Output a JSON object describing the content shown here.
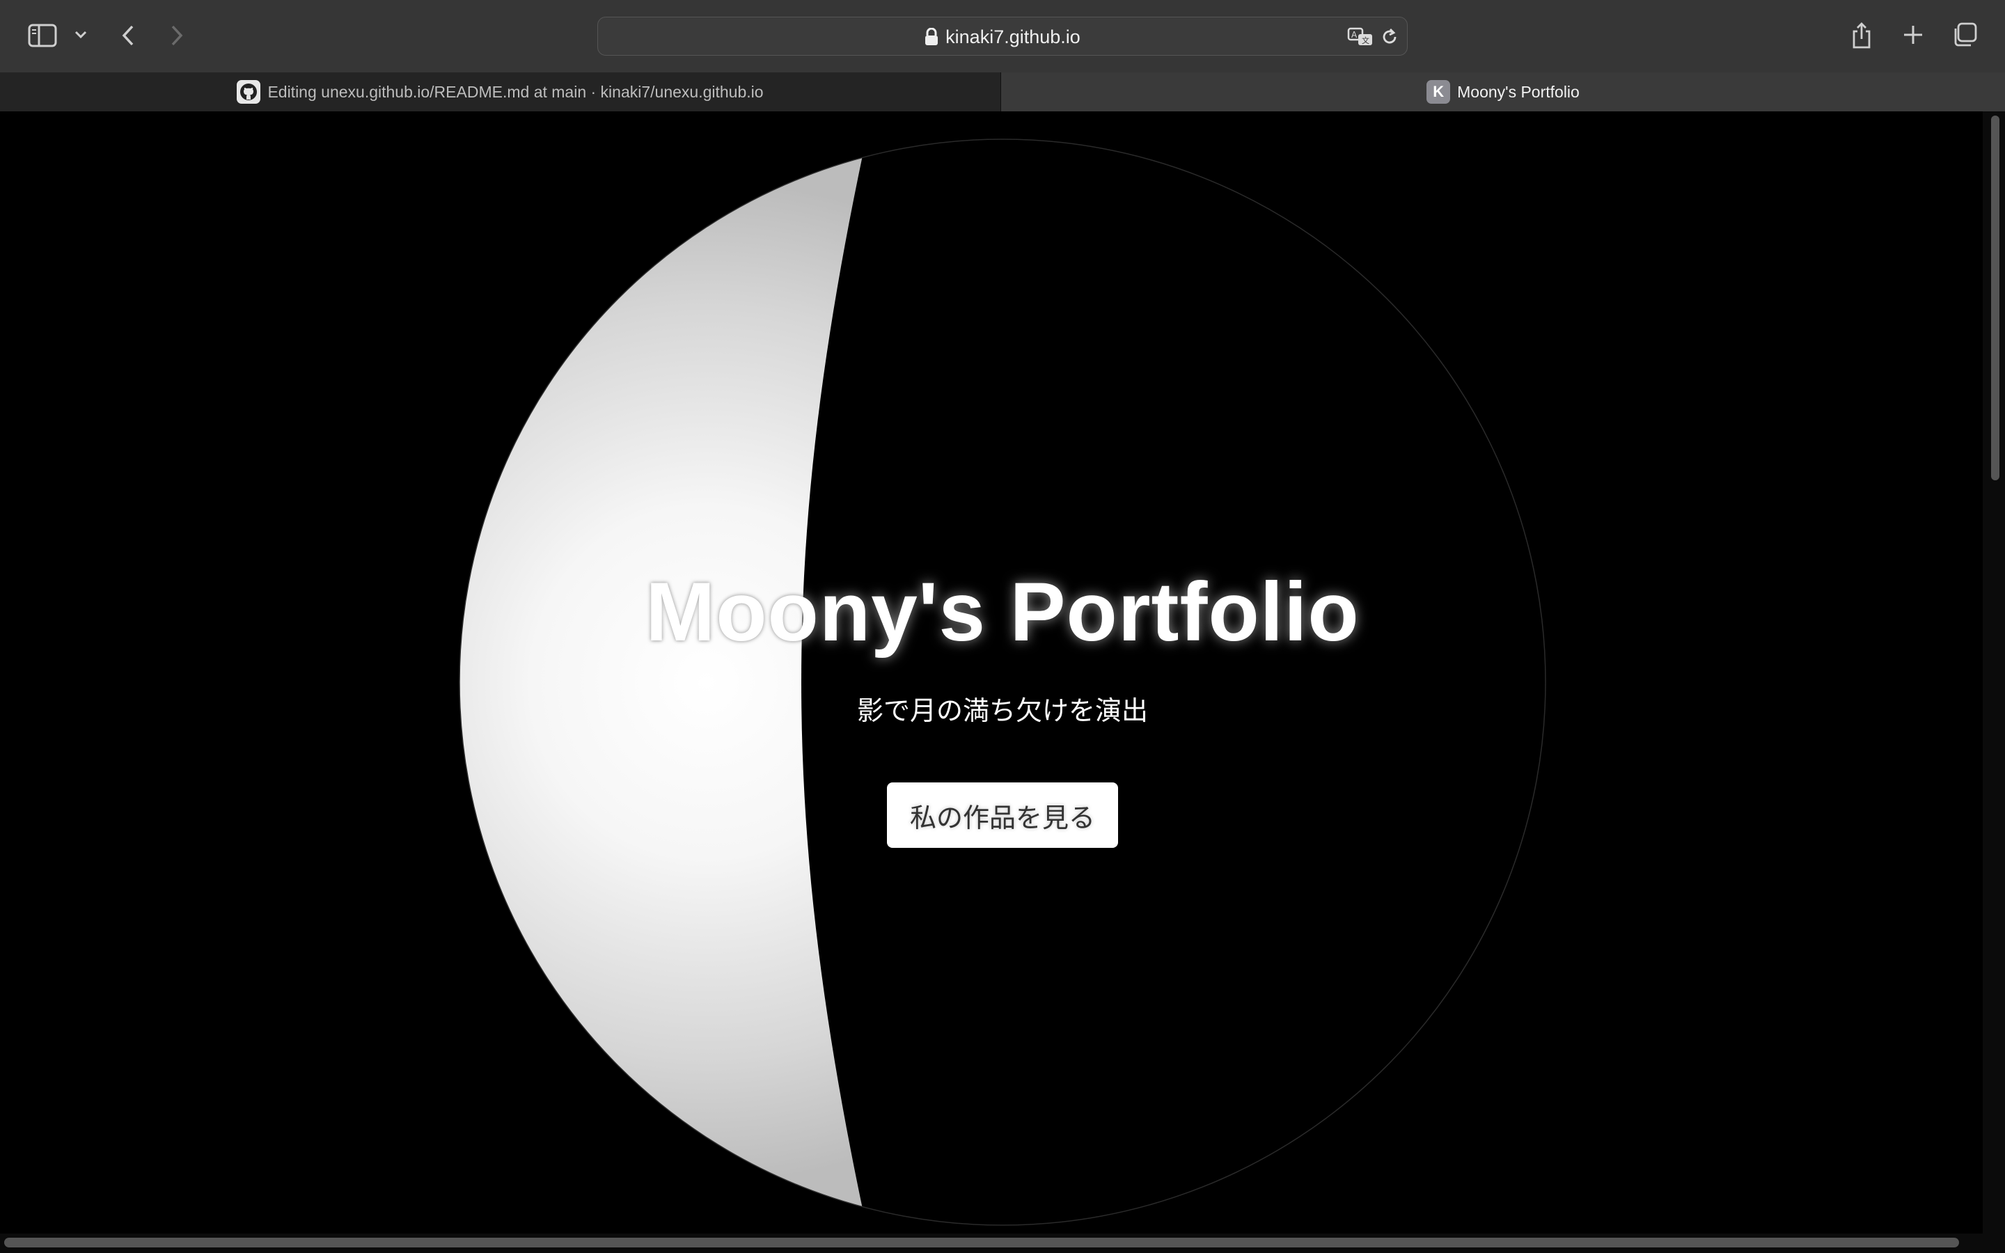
{
  "browser": {
    "address": "kinaki7.github.io",
    "tabs": [
      {
        "title": "Editing unexu.github.io/README.md at main · kinaki7/unexu.github.io",
        "favicon": "github-icon",
        "active": false
      },
      {
        "title": "Moony's Portfolio",
        "favicon_letter": "K",
        "active": true
      }
    ]
  },
  "hero": {
    "title": "Moony's Portfolio",
    "subtitle": "影で月の満ち欠けを演出",
    "cta_label": "私の作品を見る"
  },
  "colors": {
    "toolbar_bg": "#363636",
    "tab_active_bg": "#3a3a3a",
    "page_bg": "#000000",
    "moon_light": "#ffffff",
    "moon_edge": "#c8c8c8"
  }
}
